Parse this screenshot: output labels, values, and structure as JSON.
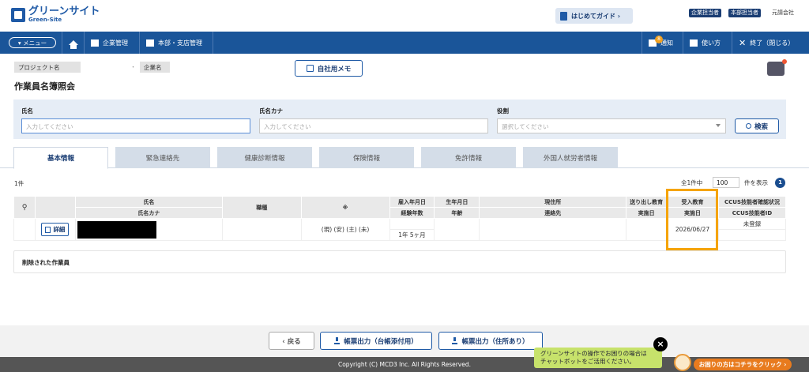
{
  "header": {
    "logo_main": "グリーンサイト",
    "logo_sub": "Green-Site",
    "guide_label": "はじめてガイド ›",
    "roles": [
      "企業担当者",
      "本部担当者"
    ],
    "company": "元請会社"
  },
  "nav": {
    "menu_label": "▾ メニュー",
    "company_mgmt": "企業管理",
    "branch_mgmt": "本部・支店管理",
    "notifications": "通知",
    "notif_count": "8",
    "usage": "使い方",
    "exit": "終了（閉じる）"
  },
  "context": {
    "project_label": "プロジェクト名",
    "separator": "・",
    "company_label": "企業名",
    "memo_label": "自社用メモ",
    "page_title": "作業員名簿照会"
  },
  "search": {
    "name_label": "氏名",
    "name_placeholder": "入力してください",
    "kana_label": "氏名カナ",
    "kana_placeholder": "入力してください",
    "role_label": "役割",
    "role_placeholder": "選択してください",
    "button": "検索"
  },
  "tabs": [
    "基本情報",
    "緊急連絡先",
    "健康診断情報",
    "保険情報",
    "免許情報",
    "外国人就労者情報"
  ],
  "results": {
    "count": "1件",
    "summary": "全1件中",
    "per_page": "100",
    "per_page_suffix": "件を表示",
    "page": "1"
  },
  "table": {
    "headers_top": [
      "氏名",
      "職種",
      "※",
      "雇入年月日",
      "生年月日",
      "現住所",
      "送り出し教育",
      "受入教育",
      "CCUS技能者確認状況"
    ],
    "headers_bottom": [
      "氏名カナ",
      "経験年数",
      "年齢",
      "連絡先",
      "実施日",
      "実施日",
      "CCUS技能者ID"
    ],
    "detail_button": "詳細",
    "row": {
      "flags": "(現) (安) (主) (未)",
      "experience": "1年 5ヶ月",
      "accept_date": "2026/06/27",
      "ccus_status": "未登録"
    }
  },
  "deleted_label": "削除された作業員",
  "footer": {
    "back": "‹ 戻る",
    "export1": "帳票出力（台帳添付用）",
    "export2": "帳票出力（住所あり）",
    "copyright": "Copyright (C) MCD3 Inc. All Rights Reserved.",
    "chatbot_line1": "グリーンサイトの操作でお困りの場合は",
    "chatbot_line2": "チャットボットをご活用ください。",
    "close": "×",
    "help": "お困りの方はコチラをクリック ›"
  }
}
